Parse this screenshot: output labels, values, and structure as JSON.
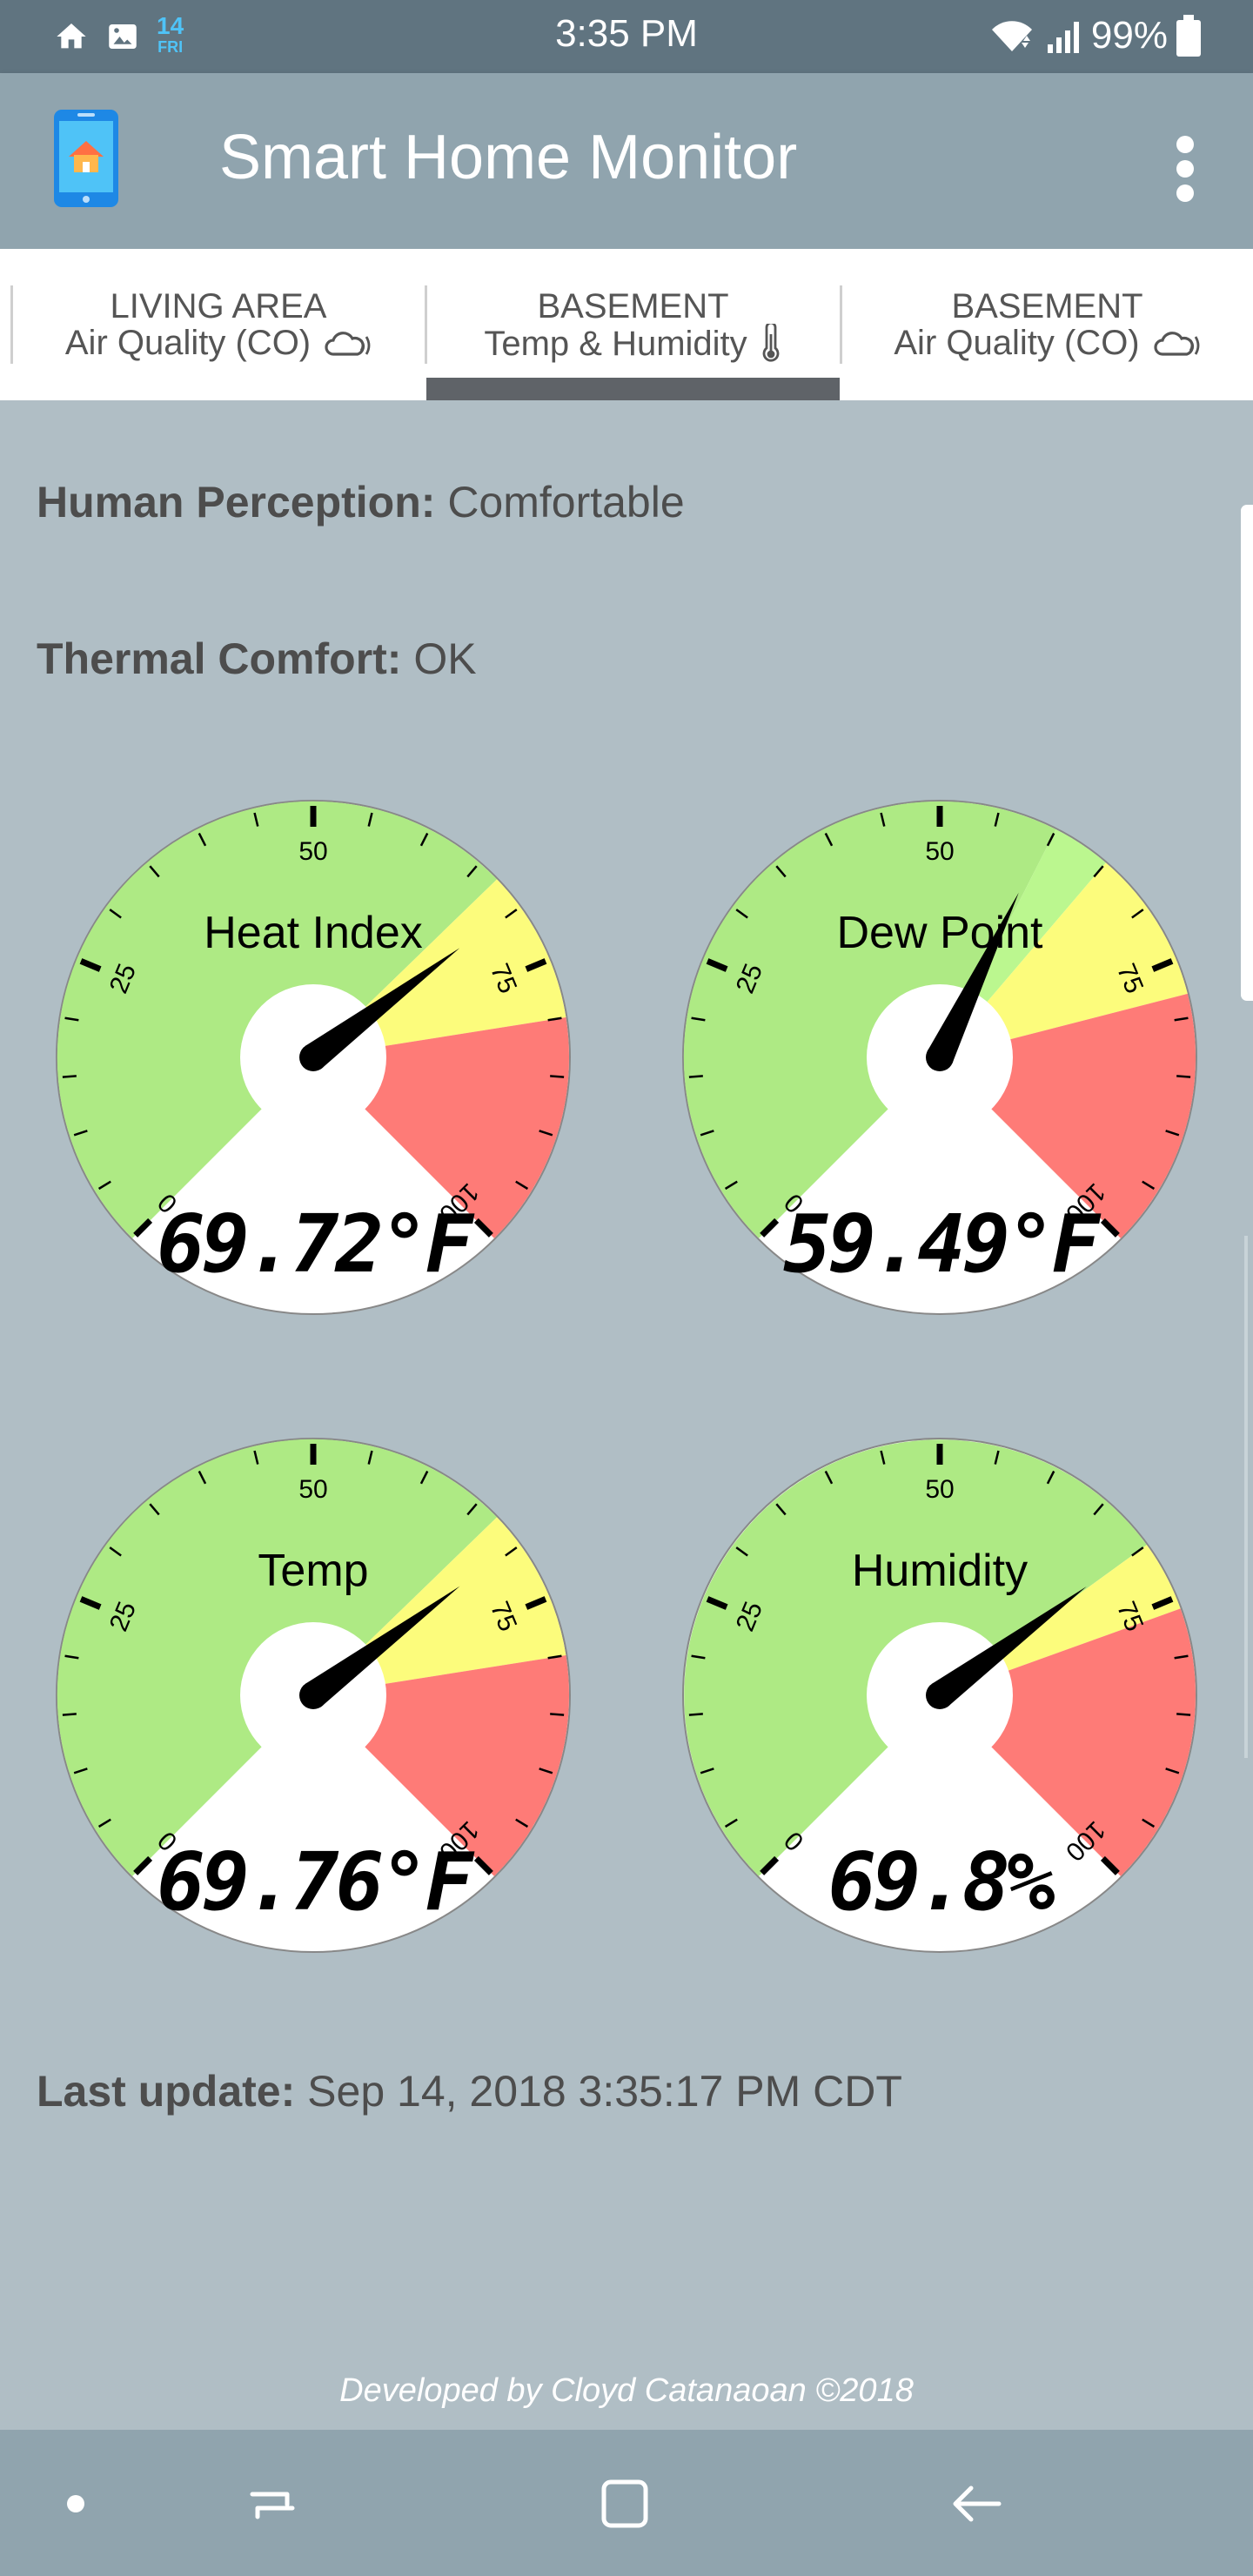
{
  "status_bar": {
    "time": "3:35 PM",
    "battery": "99%",
    "calendar_day": "14",
    "calendar_weekday": "FRI",
    "icons": [
      "home-icon",
      "image-icon",
      "calendar-icon",
      "wifi-icon",
      "signal-icon",
      "battery-icon"
    ]
  },
  "app_bar": {
    "title": "Smart Home Monitor",
    "icons": [
      "app-logo-icon",
      "overflow-menu-icon"
    ]
  },
  "tabs": [
    {
      "line1": "LIVING AREA",
      "line2": "Air Quality (CO)",
      "icon": "cloud-icon",
      "selected": false
    },
    {
      "line1": "BASEMENT",
      "line2": "Temp & Humidity",
      "icon": "thermometer-icon",
      "selected": true
    },
    {
      "line1": "BASEMENT",
      "line2": "Air Quality (CO)",
      "icon": "cloud-icon",
      "selected": false
    }
  ],
  "perception": {
    "label": "Human Perception:",
    "value": "Comfortable"
  },
  "thermal": {
    "label": "Thermal Comfort:",
    "value": "OK"
  },
  "gauges": [
    {
      "title": "Heat Index",
      "display": "69.72°F",
      "value": 69.72,
      "ticks": [
        "0",
        "25",
        "50",
        "75",
        "100"
      ]
    },
    {
      "title": "Dew Point",
      "display": "59.49°F",
      "value": 59.49,
      "ticks": [
        "0",
        "25",
        "50",
        "75",
        "100"
      ]
    },
    {
      "title": "Temp",
      "display": "69.76°F",
      "value": 69.76,
      "ticks": [
        "0",
        "25",
        "50",
        "75",
        "100"
      ]
    },
    {
      "title": "Humidity",
      "display": "69.8%",
      "value": 69.8,
      "ticks": [
        "0",
        "25",
        "50",
        "75",
        "100"
      ]
    }
  ],
  "gauge_scale": {
    "min": 0,
    "max": 100
  },
  "gauge_zones": [
    {
      "gauge": "Heat Index",
      "zones": [
        {
          "from": 0,
          "to": 67,
          "color": "#aeea84"
        },
        {
          "from": 67,
          "to": 80,
          "color": "#fcfc7c"
        },
        {
          "from": 80,
          "to": 100,
          "color": "#fe7b77"
        }
      ]
    },
    {
      "gauge": "Dew Point",
      "zones": [
        {
          "from": 0,
          "to": 60,
          "color": "#aeea84"
        },
        {
          "from": 60,
          "to": 65,
          "color": "#bbf78f"
        },
        {
          "from": 65,
          "to": 78,
          "color": "#fcfc7c"
        },
        {
          "from": 78,
          "to": 100,
          "color": "#fe7b77"
        }
      ]
    },
    {
      "gauge": "Temp",
      "zones": [
        {
          "from": 0,
          "to": 67,
          "color": "#aeea84"
        },
        {
          "from": 67,
          "to": 80,
          "color": "#fcfc7c"
        },
        {
          "from": 80,
          "to": 100,
          "color": "#fe7b77"
        }
      ]
    },
    {
      "gauge": "Humidity",
      "zones": [
        {
          "from": 0,
          "to": 70,
          "color": "#aeea84"
        },
        {
          "from": 70,
          "to": 76,
          "color": "#fcfc7c"
        },
        {
          "from": 76,
          "to": 100,
          "color": "#fe7b77"
        }
      ]
    }
  ],
  "last_update": {
    "label": "Last update:",
    "value": "Sep 14, 2018 3:35:17 PM CDT"
  },
  "footer": "Developed by Cloyd Catanaoan ©2018",
  "nav_bar": {
    "icons": [
      "dot-icon",
      "recent-apps-icon",
      "home-square-icon",
      "back-icon"
    ]
  },
  "colors": {
    "status_bar": "#607480",
    "app_bar": "#90a4ae",
    "background": "#b0bec5",
    "tab_indicator": "#5f6368",
    "gauge_green": "#aeea84",
    "gauge_yellow": "#fcfc7c",
    "gauge_red": "#fe7b77"
  }
}
